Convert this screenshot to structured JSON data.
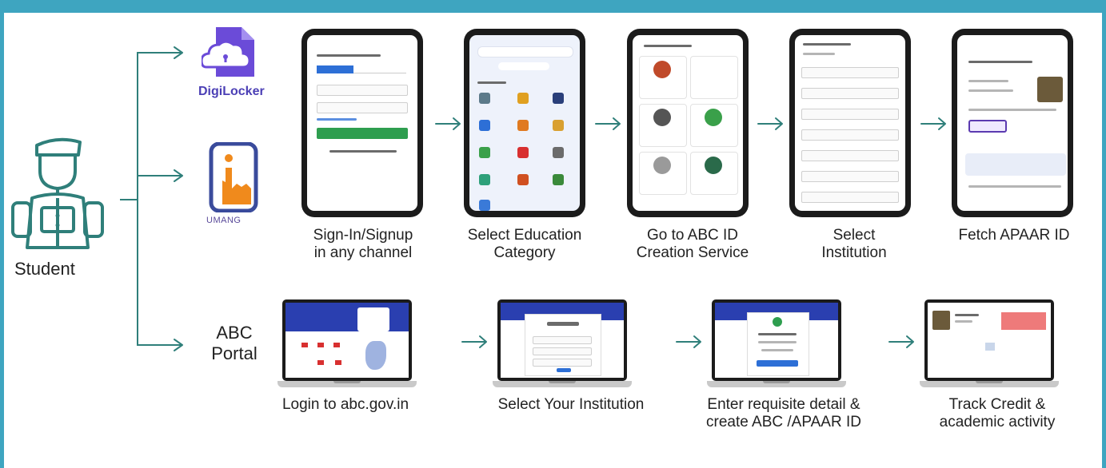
{
  "nodes": {
    "student": "Student",
    "digilocker": "DigiLocker",
    "umang": "UMANG",
    "abc_portal_line1": "ABC",
    "abc_portal_line2": "Portal"
  },
  "app_steps": [
    {
      "line1": "Sign-In/Signup",
      "line2": "in any channel"
    },
    {
      "line1": "Select Education",
      "line2": "Category"
    },
    {
      "line1": "Go to ABC ID",
      "line2": "Creation Service"
    },
    {
      "line1": "Select",
      "line2": "Institution"
    },
    {
      "line1": "Fetch APAAR ID",
      "line2": ""
    }
  ],
  "portal_steps": [
    {
      "line1": "Login to abc.gov.in",
      "line2": ""
    },
    {
      "line1": "Select Your Institution",
      "line2": ""
    },
    {
      "line1": "Enter requisite detail &",
      "line2": "create ABC /APAAR ID"
    },
    {
      "line1": "Track Credit &",
      "line2": "academic activity"
    }
  ],
  "colors": {
    "frame": "#3ea5c0",
    "connector": "#2f7f7a",
    "digilocker": "#6b4bd8",
    "umang": "#f08a1c",
    "portal_header": "#2a3fb0",
    "action_green": "#2e9e4f"
  },
  "icons": {
    "student": "student-icon",
    "digilocker": "digilocker-cloud-icon",
    "umang": "umang-hand-icon",
    "arrow": "arrow-right-icon"
  }
}
